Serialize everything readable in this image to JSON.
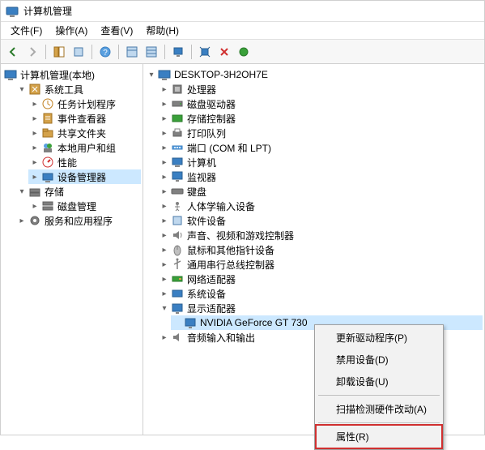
{
  "window": {
    "title": "计算机管理"
  },
  "menubar": [
    "文件(F)",
    "操作(A)",
    "查看(V)",
    "帮助(H)"
  ],
  "left_tree": {
    "root": "计算机管理(本地)",
    "groups": [
      {
        "label": "系统工具",
        "expanded": true,
        "items": [
          {
            "label": "任务计划程序"
          },
          {
            "label": "事件查看器"
          },
          {
            "label": "共享文件夹"
          },
          {
            "label": "本地用户和组"
          },
          {
            "label": "性能"
          },
          {
            "label": "设备管理器",
            "selected": true
          }
        ]
      },
      {
        "label": "存储",
        "expanded": true,
        "items": [
          {
            "label": "磁盘管理"
          }
        ]
      },
      {
        "label": "服务和应用程序",
        "expanded": false,
        "items": []
      }
    ]
  },
  "device_tree": {
    "root": "DESKTOP-3H2OH7E",
    "categories": [
      {
        "label": "处理器",
        "expanded": false
      },
      {
        "label": "磁盘驱动器",
        "expanded": false
      },
      {
        "label": "存储控制器",
        "expanded": false
      },
      {
        "label": "打印队列",
        "expanded": false
      },
      {
        "label": "端口 (COM 和 LPT)",
        "expanded": false
      },
      {
        "label": "计算机",
        "expanded": false
      },
      {
        "label": "监视器",
        "expanded": false
      },
      {
        "label": "键盘",
        "expanded": false
      },
      {
        "label": "人体学输入设备",
        "expanded": false
      },
      {
        "label": "软件设备",
        "expanded": false
      },
      {
        "label": "声音、视频和游戏控制器",
        "expanded": false
      },
      {
        "label": "鼠标和其他指针设备",
        "expanded": false
      },
      {
        "label": "通用串行总线控制器",
        "expanded": false
      },
      {
        "label": "网络适配器",
        "expanded": false
      },
      {
        "label": "系统设备",
        "expanded": false
      },
      {
        "label": "显示适配器",
        "expanded": true,
        "children": [
          {
            "label": "NVIDIA GeForce GT 730",
            "selected": true
          }
        ]
      },
      {
        "label": "音频输入和输出",
        "expanded": false
      }
    ]
  },
  "context_menu": {
    "items": [
      {
        "label": "更新驱动程序(P)"
      },
      {
        "label": "禁用设备(D)"
      },
      {
        "label": "卸载设备(U)"
      },
      {
        "sep": true
      },
      {
        "label": "扫描检测硬件改动(A)"
      },
      {
        "sep": true
      },
      {
        "label": "属性(R)",
        "highlighted": true
      }
    ]
  }
}
